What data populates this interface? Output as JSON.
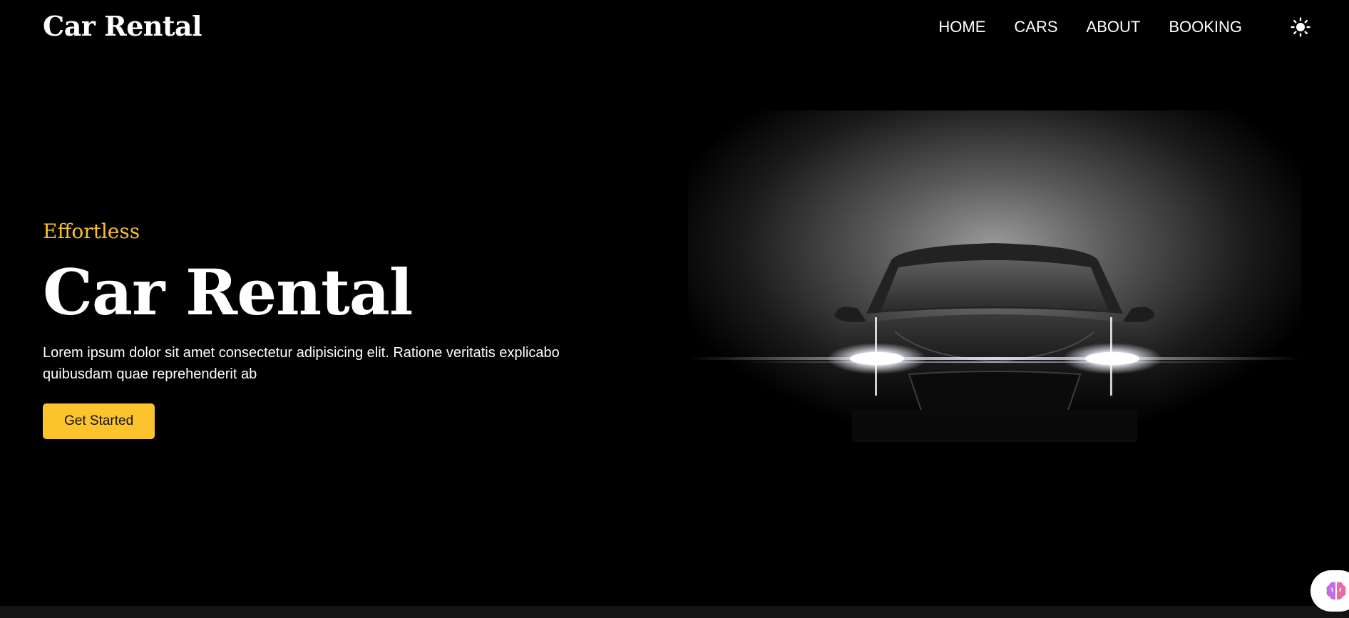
{
  "header": {
    "logo": "Car Rental",
    "nav": [
      {
        "label": "HOME"
      },
      {
        "label": "CARS"
      },
      {
        "label": "ABOUT"
      },
      {
        "label": "BOOKING"
      }
    ],
    "theme_icon": "sun-icon"
  },
  "hero": {
    "eyebrow": "Effortless",
    "title": "Car Rental",
    "description": "Lorem ipsum dolor sit amet consectetur adipisicing elit. Ratione veritatis explicabo quibusdam quae reprehenderit ab",
    "cta_label": "Get Started",
    "image_icon": "car-headlights-illustration"
  },
  "floating": {
    "icon": "brain-icon"
  },
  "colors": {
    "background": "#000000",
    "accent": "#fbc32c",
    "text": "#ffffff"
  }
}
